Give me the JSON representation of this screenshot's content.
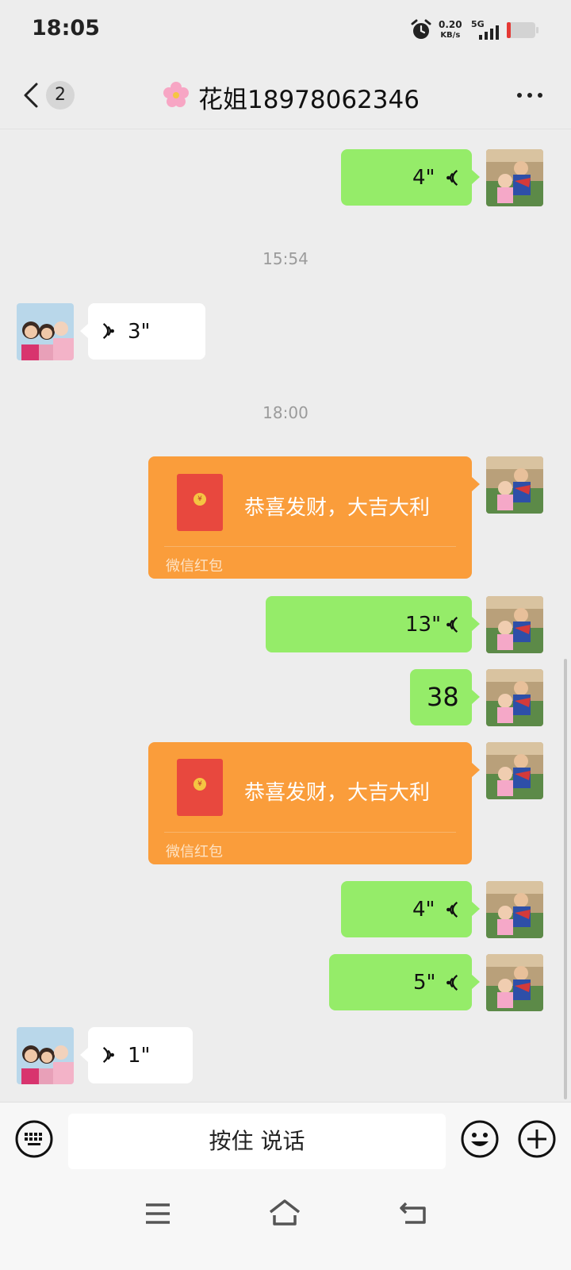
{
  "status_bar": {
    "time": "18:05",
    "net_speed_value": "0.20",
    "net_speed_unit": "KB/s",
    "network_type": "5G"
  },
  "header": {
    "unread_count": "2",
    "title": "花姐18978062346"
  },
  "messages": [
    {
      "id": "m1",
      "side": "right",
      "type": "voice",
      "duration": "4\""
    },
    {
      "id": "t1",
      "type": "time",
      "text": "15:54"
    },
    {
      "id": "m2",
      "side": "left",
      "type": "voice",
      "duration": "3\""
    },
    {
      "id": "t2",
      "type": "time",
      "text": "18:00"
    },
    {
      "id": "m3",
      "side": "right",
      "type": "red_packet",
      "greeting": "恭喜发财，大吉大利",
      "label": "微信红包",
      "coin": "¥"
    },
    {
      "id": "m4",
      "side": "right",
      "type": "voice",
      "duration": "13\""
    },
    {
      "id": "m5",
      "side": "right",
      "type": "text",
      "text": "38"
    },
    {
      "id": "m6",
      "side": "right",
      "type": "red_packet",
      "greeting": "恭喜发财，大吉大利",
      "label": "微信红包",
      "coin": "¥"
    },
    {
      "id": "m7",
      "side": "right",
      "type": "voice",
      "duration": "4\""
    },
    {
      "id": "m8",
      "side": "right",
      "type": "voice",
      "duration": "5\""
    },
    {
      "id": "m9",
      "side": "left",
      "type": "voice",
      "duration": "1\""
    }
  ],
  "input_bar": {
    "hold_to_talk": "按住 说话"
  },
  "colors": {
    "sent_bubble": "#95ec69",
    "received_bubble": "#ffffff",
    "red_packet": "#fa9d3b",
    "background": "#ededed"
  },
  "icons": [
    "alarm-icon",
    "signal-icon",
    "battery-icon",
    "back-icon",
    "flower-icon",
    "more-icon",
    "voice-wave-icon",
    "keyboard-icon",
    "emoji-icon",
    "plus-icon",
    "menu-icon",
    "home-icon",
    "return-icon"
  ]
}
